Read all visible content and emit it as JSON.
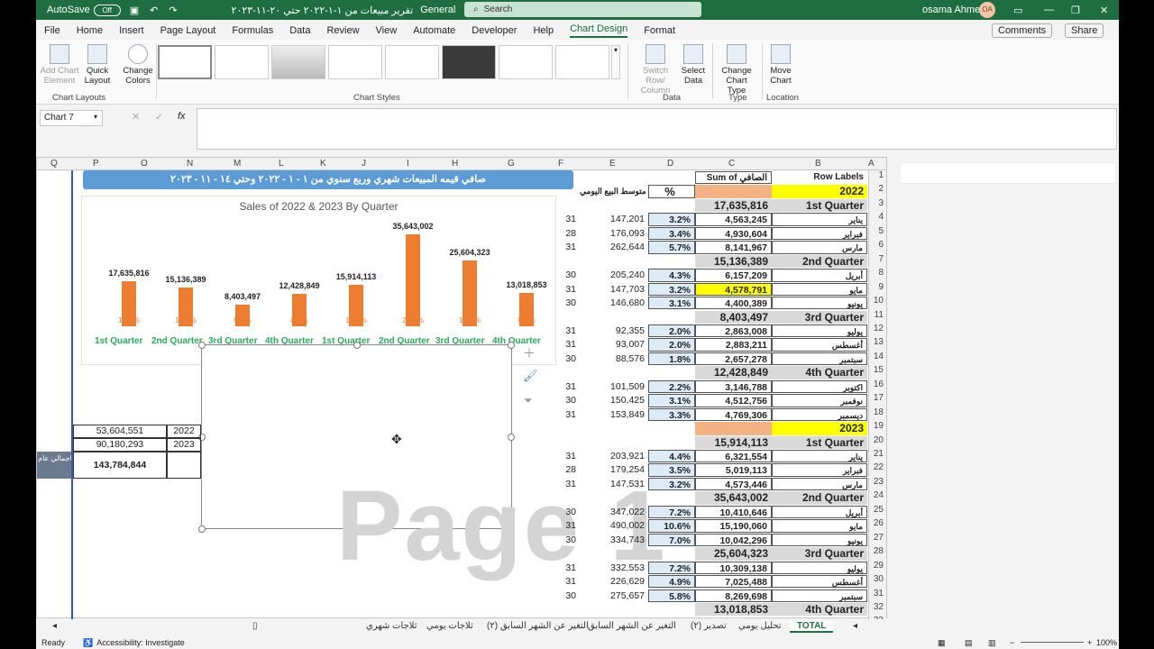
{
  "title_bar": {
    "autosave": "AutoSave",
    "toggle": "Off",
    "doc_title": "تقرير مبيعات من ١-١-٢٠٢٢ حتي ٢٠-١١-٢٠٢٣",
    "sensitivity": "General",
    "search_placeholder": "Search",
    "user": "osama Ahmed",
    "initials": "OA"
  },
  "menu": [
    "File",
    "Home",
    "Insert",
    "Page Layout",
    "Formulas",
    "Data",
    "Review",
    "View",
    "Automate",
    "Developer",
    "Help",
    "Chart Design",
    "Format"
  ],
  "menu_active": "Chart Design",
  "menu_right": {
    "comments": "Comments",
    "share": "Share"
  },
  "ribbon": {
    "add_chart_element": "Add Chart Element",
    "quick_layout": "Quick Layout",
    "change_colors": "Change Colors",
    "group_layouts": "Chart Layouts",
    "group_styles": "Chart Styles",
    "switch": "Switch Row/ Column",
    "select_data": "Select Data",
    "group_data": "Data",
    "change_type": "Change Chart Type",
    "group_type": "Type",
    "move_chart": "Move Chart",
    "group_location": "Location"
  },
  "name_box": "Chart 7",
  "columns": [
    "Q",
    "P",
    "O",
    "N",
    "M",
    "L",
    "K",
    "J",
    "I",
    "H",
    "G",
    "F",
    "E",
    "D",
    "C",
    "B",
    "A"
  ],
  "banner": "صافي قيمه المبيعات شهري وربع سنوي من ١ - ١ - ٢٠٢٢ وحتي ١٤ - ١١ - ٢٠٢٣",
  "chart_data": {
    "type": "bar",
    "title": "Sales of 2022 & 2023 By Quarter",
    "categories": [
      "1st Quarter",
      "2nd Quarter",
      "3rd Quarter",
      "4th Quarter",
      "1st Quarter",
      "2nd Quarter",
      "3rd Quarter",
      "4th Quarter"
    ],
    "value_labels": [
      "17,635,816",
      "15,136,389",
      "8,403,497",
      "12,428,849",
      "15,914,113",
      "35,643,002",
      "25,604,323",
      "13,018,853"
    ],
    "values": [
      17635816,
      15136389,
      8403497,
      12428849,
      15914113,
      35643002,
      25604323,
      13018853
    ],
    "percent_labels": [
      "12.3%",
      "10.5%",
      "5.8%",
      "8.6%",
      "11.1%",
      "24.8%",
      "17.8%",
      "9.1%"
    ],
    "color": "#ed7d31"
  },
  "summary": {
    "v2022": "53,604,551",
    "y2022": "2022",
    "v2023": "90,180,293",
    "y2023": "2023",
    "total": "143,784,844",
    "total_label": "اجمالي عام"
  },
  "pivot_headers": {
    "sum_of": "Sum of",
    "net": "الصافي",
    "row_labels": "Row Labels",
    "avg": "متوسط البيع اليومي",
    "pct": "%"
  },
  "rows": [
    {
      "r": "2",
      "b": "Row Labels",
      "c": "Sum of الصافي",
      "d": "",
      "e": "",
      "f": ""
    },
    {
      "r": "3",
      "b": "2022",
      "c": "",
      "d": "%",
      "e": "متوسط البيع اليومي",
      "f": ""
    },
    {
      "r": "4",
      "b": "1st Quarter",
      "c": "17,635,816",
      "d": "",
      "e": "",
      "f": ""
    },
    {
      "r": "5",
      "b": "يناير",
      "c": "4,563,245",
      "d": "3.2%",
      "e": "147,201",
      "f": "31"
    },
    {
      "r": "6",
      "b": "فبراير",
      "c": "4,930,604",
      "d": "3.4%",
      "e": "176,093",
      "f": "28"
    },
    {
      "r": "7",
      "b": "مارس",
      "c": "8,141,967",
      "d": "5.7%",
      "e": "262,644",
      "f": "31"
    },
    {
      "r": "8",
      "b": "2nd Quarter",
      "c": "15,136,389",
      "d": "",
      "e": "",
      "f": ""
    },
    {
      "r": "9",
      "b": "أبريل",
      "c": "6,157,209",
      "d": "4.3%",
      "e": "205,240",
      "f": "30"
    },
    {
      "r": "10",
      "b": "مايو",
      "c": "4,578,791",
      "d": "3.2%",
      "e": "147,703",
      "f": "31"
    },
    {
      "r": "11",
      "b": "يونيو",
      "c": "4,400,389",
      "d": "3.1%",
      "e": "146,680",
      "f": "30"
    },
    {
      "r": "12",
      "b": "3rd Quarter",
      "c": "8,403,497",
      "d": "",
      "e": "",
      "f": ""
    },
    {
      "r": "13",
      "b": "يوليو",
      "c": "2,863,008",
      "d": "2.0%",
      "e": "92,355",
      "f": "31"
    },
    {
      "r": "14",
      "b": "أغسطس",
      "c": "2,883,211",
      "d": "2.0%",
      "e": "93,007",
      "f": "31"
    },
    {
      "r": "15",
      "b": "سبتمبر",
      "c": "2,657,278",
      "d": "1.8%",
      "e": "88,576",
      "f": "30"
    },
    {
      "r": "16",
      "b": "4th Quarter",
      "c": "12,428,849",
      "d": "",
      "e": "",
      "f": ""
    },
    {
      "r": "17",
      "b": "اكتوبر",
      "c": "3,146,788",
      "d": "2.2%",
      "e": "101,509",
      "f": "31"
    },
    {
      "r": "18",
      "b": "نوفمبر",
      "c": "4,512,756",
      "d": "3.1%",
      "e": "150,425",
      "f": "30"
    },
    {
      "r": "19",
      "b": "ديسمبر",
      "c": "4,769,306",
      "d": "3.3%",
      "e": "153,849",
      "f": "31"
    },
    {
      "r": "20",
      "b": "2023",
      "c": "",
      "d": "",
      "e": "",
      "f": ""
    },
    {
      "r": "21",
      "b": "1st Quarter",
      "c": "15,914,113",
      "d": "",
      "e": "",
      "f": ""
    },
    {
      "r": "22",
      "b": "يناير",
      "c": "6,321,554",
      "d": "4.4%",
      "e": "203,921",
      "f": "31"
    },
    {
      "r": "23",
      "b": "فبراير",
      "c": "5,019,113",
      "d": "3.5%",
      "e": "179,254",
      "f": "28"
    },
    {
      "r": "24",
      "b": "مارس",
      "c": "4,573,446",
      "d": "3.2%",
      "e": "147,531",
      "f": "31"
    },
    {
      "r": "25",
      "b": "2nd Quarter",
      "c": "35,643,002",
      "d": "",
      "e": "",
      "f": ""
    },
    {
      "r": "26",
      "b": "أبريل",
      "c": "10,410,646",
      "d": "7.2%",
      "e": "347,022",
      "f": "30"
    },
    {
      "r": "27",
      "b": "مايو",
      "c": "15,190,060",
      "d": "10.6%",
      "e": "490,002",
      "f": "31"
    },
    {
      "r": "28",
      "b": "يونيو",
      "c": "10,042,296",
      "d": "7.0%",
      "e": "334,743",
      "f": "30"
    },
    {
      "r": "29",
      "b": "3rd Quarter",
      "c": "25,604,323",
      "d": "",
      "e": "",
      "f": ""
    },
    {
      "r": "30",
      "b": "يوليو",
      "c": "10,309,138",
      "d": "7.2%",
      "e": "332,553",
      "f": "31"
    },
    {
      "r": "31",
      "b": "أغسطس",
      "c": "7,025,488",
      "d": "4.9%",
      "e": "226,629",
      "f": "31"
    },
    {
      "r": "32",
      "b": "سبتمبر",
      "c": "8,269,698",
      "d": "5.8%",
      "e": "275,657",
      "f": "30"
    },
    {
      "r": "33",
      "b": "4th Quarter",
      "c": "13,018,853",
      "d": "",
      "e": "",
      "f": ""
    }
  ],
  "watermark": "Page 1",
  "sheet_tabs": [
    "TOTAL",
    "تحليل يومي",
    "تصدير (٢)",
    "التغير عن الشهر السابق",
    "التغير عن الشهر السابق (٢)",
    "ثلاجات يومي",
    "ثلاجات شهري"
  ],
  "status": {
    "ready": "Ready",
    "accessibility": "Accessibility: Investigate",
    "zoom": "100%"
  }
}
